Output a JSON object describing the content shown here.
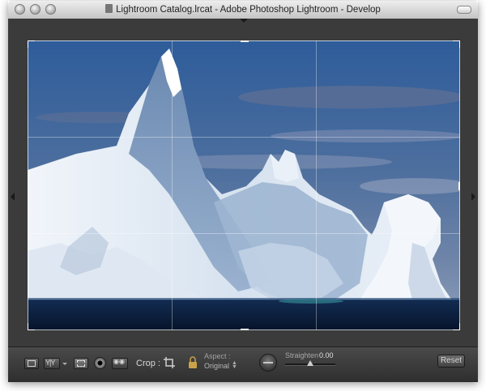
{
  "window": {
    "title": "Lightroom Catalog.lrcat - Adobe Photoshop Lightroom - Develop"
  },
  "toolbar": {
    "crop_label": "Crop :",
    "aspect_label": "Aspect :",
    "aspect_value": "Original",
    "straighten_label": "Straighten",
    "straighten_value": "0.00",
    "straighten_level": 0.5,
    "reset_label": "Reset"
  },
  "icons": {
    "view_mode": "loupe-view-icon",
    "compare_mode": "before-after-icon",
    "crop_tool": "crop-overlay-icon",
    "spot_removal": "spot-removal-icon",
    "red_eye": "red-eye-icon",
    "crop_frame": "crop-frame-icon",
    "lock": "lock-icon",
    "straighten_tool": "level-icon"
  },
  "colors": {
    "workspace_bg": "#3b3b3b",
    "toolbar_bg": "#3a3a3a",
    "sky_top": "#2e5c9a",
    "sea": "#0b1f3d",
    "ice": "#e8f0f8"
  }
}
